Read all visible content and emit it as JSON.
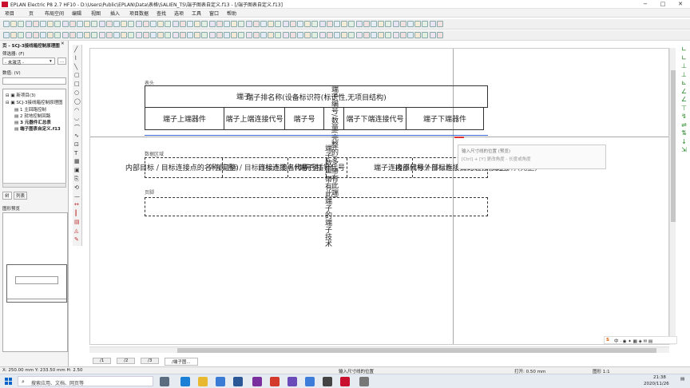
{
  "window": {
    "title": "EPLAN Electric P8 2.7 HF10 - D:\\Users\\Public\\EPLAN\\Data\\表格\\SALIEN_TS\\端子图表自定义.f13 - [/端子图表自定义.f13]"
  },
  "menu": [
    "项目",
    "页",
    "布局空间",
    "编辑",
    "视图",
    "插入",
    "项目数据",
    "查找",
    "选项",
    "工具",
    "窗口",
    "帮助"
  ],
  "left_panel": {
    "title": "页 - SCJ-3接线箱控制原理图",
    "filter_label": "筛选器: (F)",
    "filter_value": "- 未激活 -",
    "filter_btn": "...",
    "value_label": "数值: (V)",
    "tree": [
      {
        "label": "新项目(3)",
        "level": 0
      },
      {
        "label": "SCJ-3接线箱控制原理图",
        "level": 0
      },
      {
        "label": "1 主回路控制",
        "level": 1
      },
      {
        "label": "2 就地控制回路",
        "level": 1
      },
      {
        "label": "3 元器件汇总表",
        "level": 1
      },
      {
        "label": "端子图表自定义.f13",
        "level": 1
      }
    ],
    "tabs": [
      "树",
      "列表"
    ],
    "preview_title": "图形预览"
  },
  "canvas": {
    "section_header": "表头",
    "section_data": "数据区域",
    "section_footer": "页脚",
    "header_row1": "端子排名称(设备标识符(标识性,无项目结构)",
    "header_row1_overlap": "端子",
    "header_vert": "端子编号/数量(完整的/多,带有此端子的端子技术",
    "header_cols": [
      "端子上端器件",
      "端子上端连接代号",
      "端子号",
      "端子下端连接代号",
      "端子下端器件"
    ],
    "data_row": [
      "内部目标 / 目标连接点的名称(完整)",
      "目标连接点代号",
      "端子/插针代号",
      "端子连接点代号",
      "内部目标 / 目标连接点的名称(完整)"
    ],
    "data_overlap_left": "外部目标 / 目标连接点的名称(完整)",
    "data_overlap_right": "外部目标 / 目标连接点的名称(完整)",
    "vert_text": "端子数量,带有此端子的端子技术参数描述的图形",
    "tooltip_line1": "输入尺寸线的位置 (预览)",
    "tooltip_line2": "[Ctrl] + [Y] 更改角度 - 长度或角度"
  },
  "page_tabs": [
    "/1",
    "/2",
    "/3",
    "/端子图..."
  ],
  "status": {
    "coords": "X: 250.00 mm    Y: 233.50 mm    H: 2.50",
    "message": "输入尺寸线的位置",
    "grid": "打开: 0.50 mm",
    "scale": "图形 1:1"
  },
  "taskbar": {
    "search_placeholder": "搜索应用、文档、网页等",
    "time": "21:38",
    "date": "2020/11/26"
  }
}
